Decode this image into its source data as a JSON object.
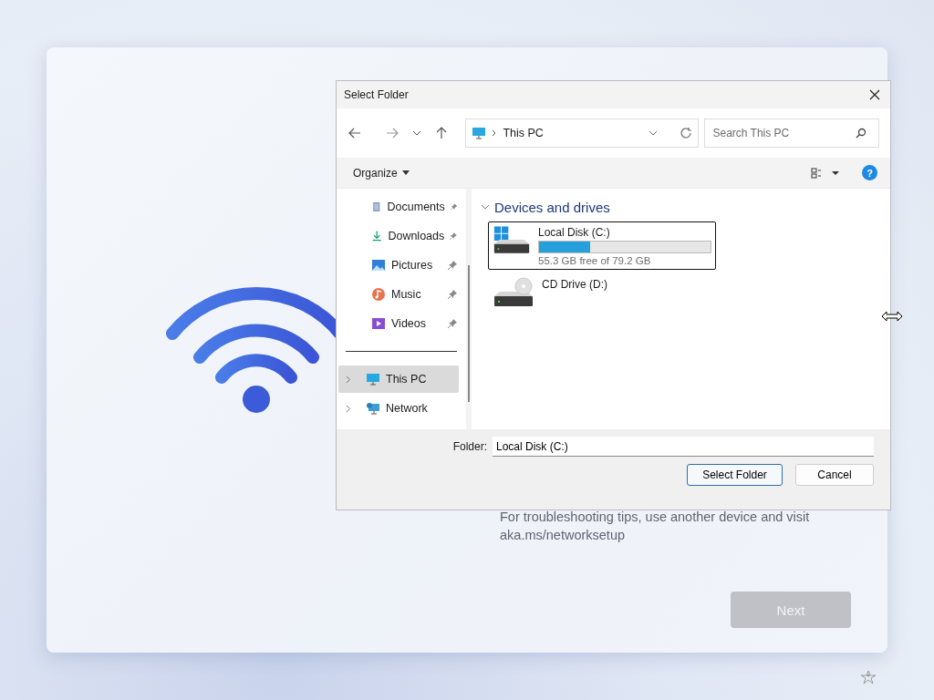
{
  "window": {
    "title": "Select Folder"
  },
  "address": {
    "location": "This PC"
  },
  "search": {
    "placeholder": "Search This PC"
  },
  "toolbar": {
    "organize": "Organize",
    "help": "?"
  },
  "nav_items": [
    {
      "label": "Documents",
      "kind": "documents",
      "pinned": true,
      "expandable": false,
      "selected": false
    },
    {
      "label": "Downloads",
      "kind": "downloads",
      "pinned": true,
      "expandable": false,
      "selected": false
    },
    {
      "label": "Pictures",
      "kind": "pictures",
      "pinned": true,
      "expandable": false,
      "selected": false
    },
    {
      "label": "Music",
      "kind": "music",
      "pinned": true,
      "expandable": false,
      "selected": false
    },
    {
      "label": "Videos",
      "kind": "videos",
      "pinned": true,
      "expandable": false,
      "selected": false
    },
    {
      "label": "This PC",
      "kind": "pc",
      "pinned": false,
      "expandable": true,
      "selected": true
    },
    {
      "label": "Network",
      "kind": "network",
      "pinned": false,
      "expandable": true,
      "selected": false
    }
  ],
  "section": {
    "title": "Devices and drives",
    "expanded": true
  },
  "drives": [
    {
      "kind": "disk",
      "name": "Local Disk (C:)",
      "level": 0.3,
      "detail": "55.3 GB free of 79.2 GB",
      "selected": true
    },
    {
      "kind": "cd",
      "name": "CD Drive (D:)",
      "selected": false
    }
  ],
  "folder": {
    "label": "Folder:",
    "value": "Local Disk (C:)"
  },
  "buttons": [
    {
      "label": "Select Folder",
      "default": true
    },
    {
      "label": "Cancel",
      "default": false
    }
  ],
  "setup": {
    "tip": "For troubleshooting tips, use another device and visit aka.ms/networksetup",
    "next": {
      "label": "Next",
      "disabled": true
    }
  }
}
